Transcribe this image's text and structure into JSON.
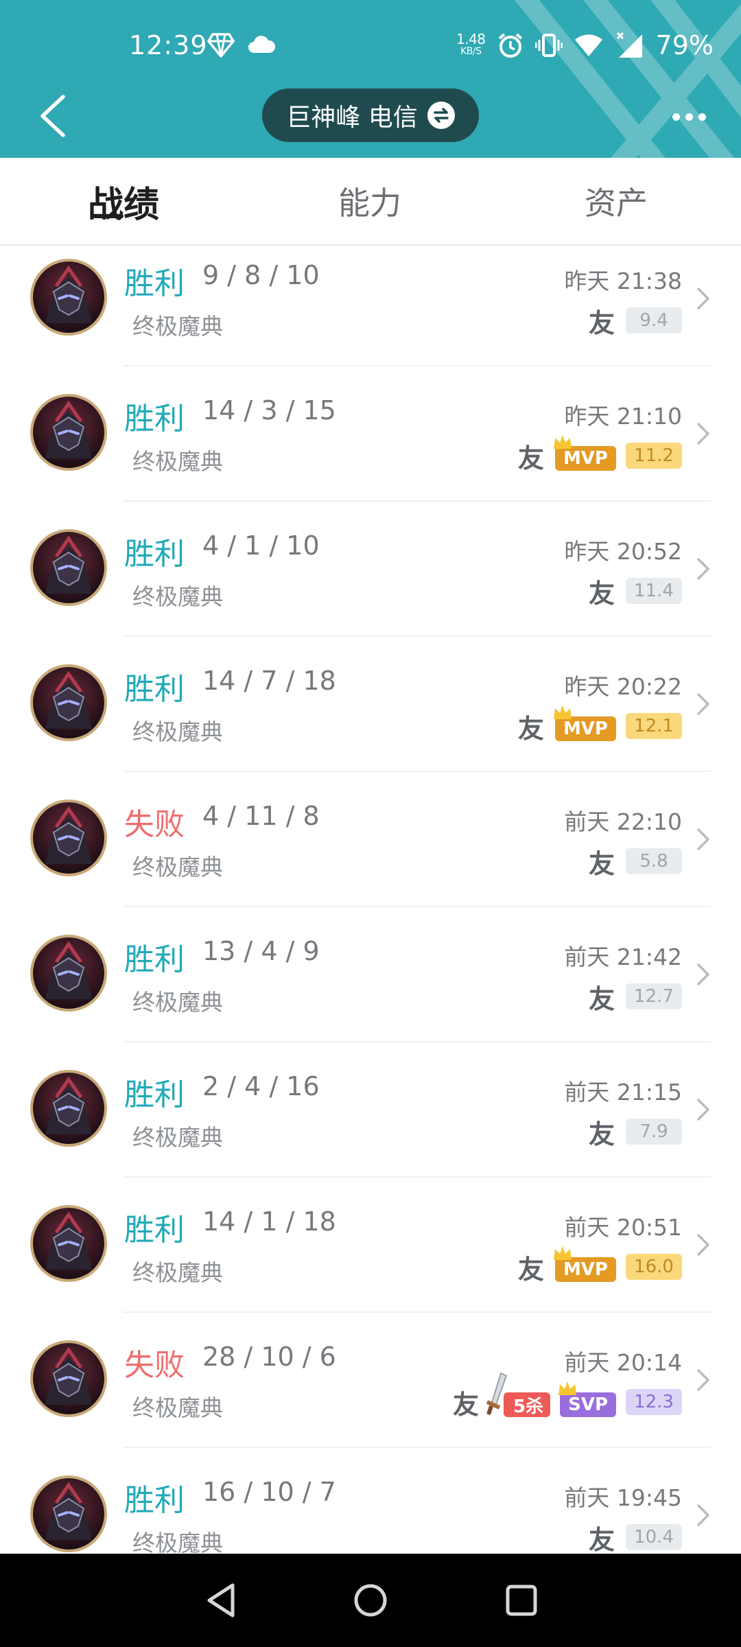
{
  "status_bar": {
    "time": "12:39",
    "net_speed_value": "1.48",
    "net_speed_unit": "KB/S",
    "battery": "79%"
  },
  "nav": {
    "server_label": "巨神峰 电信"
  },
  "tabs": [
    {
      "label": "战绩"
    },
    {
      "label": "能力"
    },
    {
      "label": "资产"
    }
  ],
  "matches": [
    {
      "result": "胜利",
      "kda": "9 / 8 / 10",
      "mode": "终极魔典",
      "time": "昨天 21:38",
      "friend": "友",
      "score": "9.4"
    },
    {
      "result": "胜利",
      "kda": "14 / 3 / 15",
      "mode": "终极魔典",
      "time": "昨天 21:10",
      "friend": "友",
      "badge": "MVP",
      "score": "11.2"
    },
    {
      "result": "胜利",
      "kda": "4 / 1 / 10",
      "mode": "终极魔典",
      "time": "昨天 20:52",
      "friend": "友",
      "score": "11.4"
    },
    {
      "result": "胜利",
      "kda": "14 / 7 / 18",
      "mode": "终极魔典",
      "time": "昨天 20:22",
      "friend": "友",
      "badge": "MVP",
      "score": "12.1"
    },
    {
      "result": "失败",
      "kda": "4 / 11 / 8",
      "mode": "终极魔典",
      "time": "前天 22:10",
      "friend": "友",
      "score": "5.8"
    },
    {
      "result": "胜利",
      "kda": "13 / 4 / 9",
      "mode": "终极魔典",
      "time": "前天 21:42",
      "friend": "友",
      "score": "12.7"
    },
    {
      "result": "胜利",
      "kda": "2 / 4 / 16",
      "mode": "终极魔典",
      "time": "前天 21:15",
      "friend": "友",
      "score": "7.9"
    },
    {
      "result": "胜利",
      "kda": "14 / 1 / 18",
      "mode": "终极魔典",
      "time": "前天 20:51",
      "friend": "友",
      "badge": "MVP",
      "score": "16.0"
    },
    {
      "result": "失败",
      "kda": "28 / 10 / 6",
      "mode": "终极魔典",
      "time": "前天 20:14",
      "friend": "友",
      "penta": "5杀",
      "badge": "SVP",
      "score": "12.3"
    },
    {
      "result": "胜利",
      "kda": "16 / 10 / 7",
      "mode": "终极魔典",
      "time": "前天 19:45",
      "friend": "友",
      "score": "10.4"
    }
  ],
  "colors": {
    "header": "#2fa9b3",
    "win": "#21a9b8",
    "lose": "#ef6e6e",
    "mvp": "#e49a23",
    "svp": "#9a6ddd",
    "penta": "#ee5a57"
  }
}
